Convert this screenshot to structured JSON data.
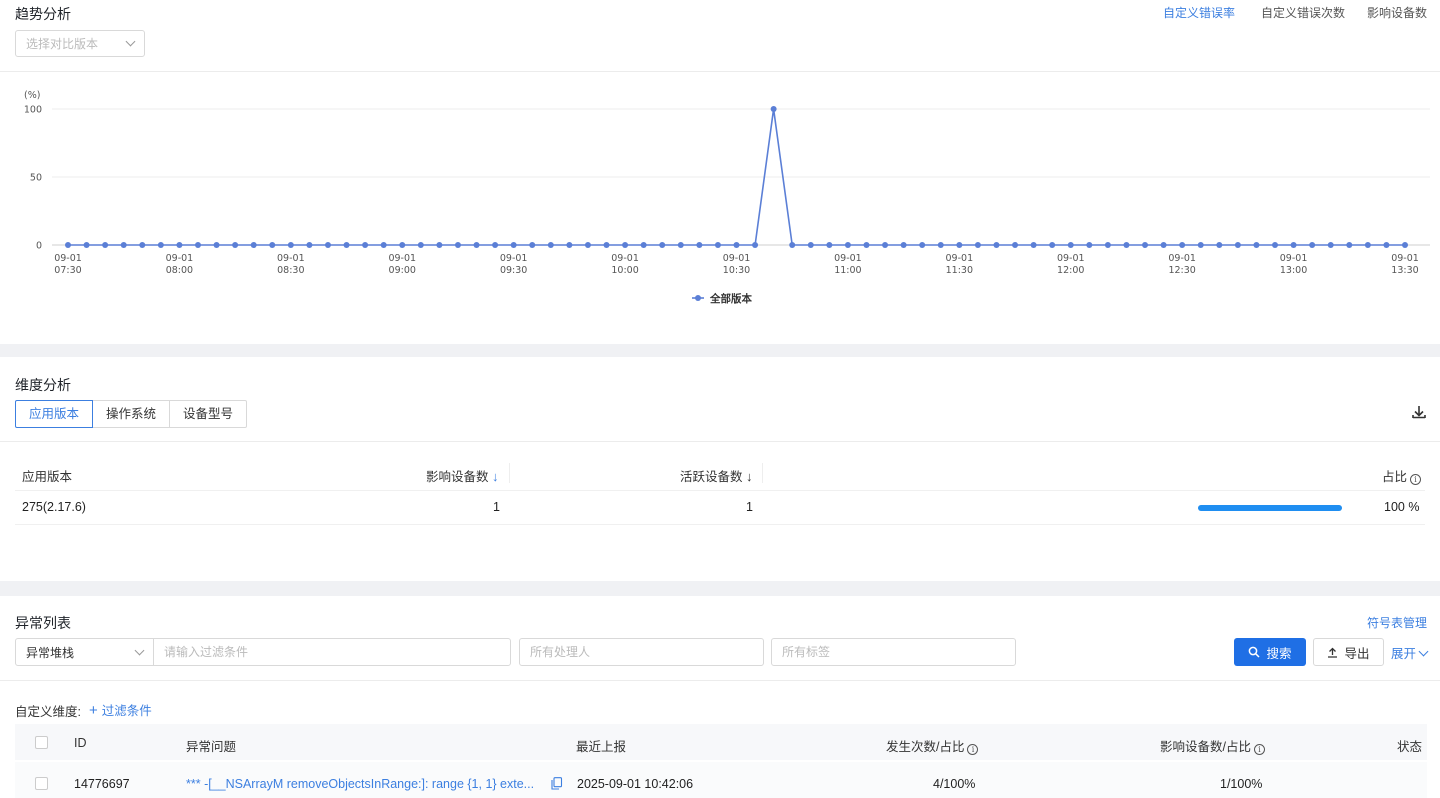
{
  "trend": {
    "title": "趋势分析",
    "compare_placeholder": "选择对比版本",
    "metric_tabs": [
      "自定义错误率",
      "自定义错误次数",
      "影响设备数"
    ],
    "active_metric": 0
  },
  "chart_data": {
    "type": "line",
    "ylabel": "(%)",
    "ylim": [
      0,
      100
    ],
    "yticks": [
      0,
      50,
      100
    ],
    "x_ticks": [
      {
        "date": "09-01",
        "time": "07:30"
      },
      {
        "date": "09-01",
        "time": "08:00"
      },
      {
        "date": "09-01",
        "time": "08:30"
      },
      {
        "date": "09-01",
        "time": "09:00"
      },
      {
        "date": "09-01",
        "time": "09:30"
      },
      {
        "date": "09-01",
        "time": "10:00"
      },
      {
        "date": "09-01",
        "time": "10:30"
      },
      {
        "date": "09-01",
        "time": "11:00"
      },
      {
        "date": "09-01",
        "time": "11:30"
      },
      {
        "date": "09-01",
        "time": "12:00"
      },
      {
        "date": "09-01",
        "time": "12:30"
      },
      {
        "date": "09-01",
        "time": "13:00"
      },
      {
        "date": "09-01",
        "time": "13:30"
      }
    ],
    "x_start": "07:30",
    "x_end": "13:30",
    "interval_minutes": 5,
    "legend_position": "bottom-center",
    "grid": true,
    "color": "#5b7fd6",
    "series": [
      {
        "name": "全部版本",
        "values": [
          0,
          0,
          0,
          0,
          0,
          0,
          0,
          0,
          0,
          0,
          0,
          0,
          0,
          0,
          0,
          0,
          0,
          0,
          0,
          0,
          0,
          0,
          0,
          0,
          0,
          0,
          0,
          0,
          0,
          0,
          0,
          0,
          0,
          0,
          0,
          0,
          0,
          0,
          100,
          0,
          0,
          0,
          0,
          0,
          0,
          0,
          0,
          0,
          0,
          0,
          0,
          0,
          0,
          0,
          0,
          0,
          0,
          0,
          0,
          0,
          0,
          0,
          0,
          0,
          0,
          0,
          0,
          0,
          0,
          0,
          0,
          0,
          0
        ]
      }
    ]
  },
  "dimension": {
    "title": "维度分析",
    "tabs": [
      "应用版本",
      "操作系统",
      "设备型号"
    ],
    "active_tab": 0,
    "columns": [
      "应用版本",
      "影响设备数",
      "活跃设备数",
      "占比"
    ],
    "rows": [
      {
        "version": "275(2.17.6)",
        "affected": "1",
        "active": "1",
        "ratio_text": "100 %",
        "ratio": 1.0
      }
    ],
    "progress_color": "#1f8ef1"
  },
  "exceptions": {
    "title": "异常列表",
    "symbol_link": "符号表管理",
    "filter_type": "异常堆栈",
    "filter_placeholder": "请输入过滤条件",
    "assignee_placeholder": "所有处理人",
    "tag_placeholder": "所有标签",
    "search_label": "搜索",
    "export_label": "导出",
    "expand_label": "展开",
    "custom_dim_label": "自定义维度:",
    "add_filter_label": "过滤条件",
    "columns": [
      "ID",
      "异常问题",
      "最近上报",
      "发生次数/占比",
      "影响设备数/占比",
      "状态"
    ],
    "rows": [
      {
        "id": "14776697",
        "issue": "*** -[__NSArrayM removeObjectsInRange:]: range {1, 1} exte...",
        "last_report": "2025-09-01 10:42:06",
        "count": "4/100%",
        "devices": "1/100%",
        "status": ""
      }
    ]
  }
}
